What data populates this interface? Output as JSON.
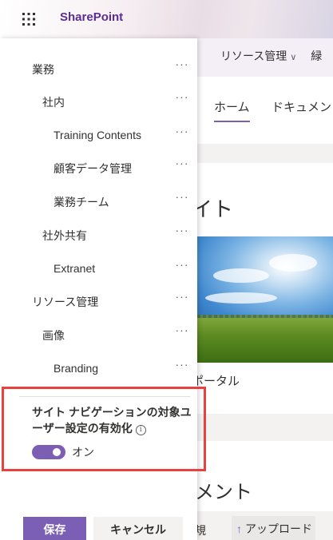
{
  "header": {
    "brand": "SharePoint"
  },
  "hub_nav": {
    "resources": "リソース管理",
    "next": "緑"
  },
  "site_tabs": {
    "home": "ホーム",
    "documents": "ドキュメント"
  },
  "site": {
    "title_fragment": "イト",
    "portal_fragment": "ポータル",
    "documents_fragment": "メント"
  },
  "command_bar": {
    "new_fragment": "規",
    "upload": "アップロード"
  },
  "nav_panel": {
    "items": [
      {
        "label": "業務"
      },
      {
        "label": "社内"
      },
      {
        "label": "Training Contents"
      },
      {
        "label": "顧客データ管理"
      },
      {
        "label": "業務チーム"
      },
      {
        "label": "社外共有"
      },
      {
        "label": "Extranet"
      },
      {
        "label": "リソース管理"
      },
      {
        "label": "画像"
      },
      {
        "label": "Branding"
      }
    ],
    "more_glyph": "···",
    "audience_setting": {
      "title": "サイト ナビゲーションの対象ユーザー設定の有効化",
      "toggle_state": "オン",
      "enabled": true
    },
    "save_label": "保存",
    "cancel_label": "キャンセル"
  }
}
